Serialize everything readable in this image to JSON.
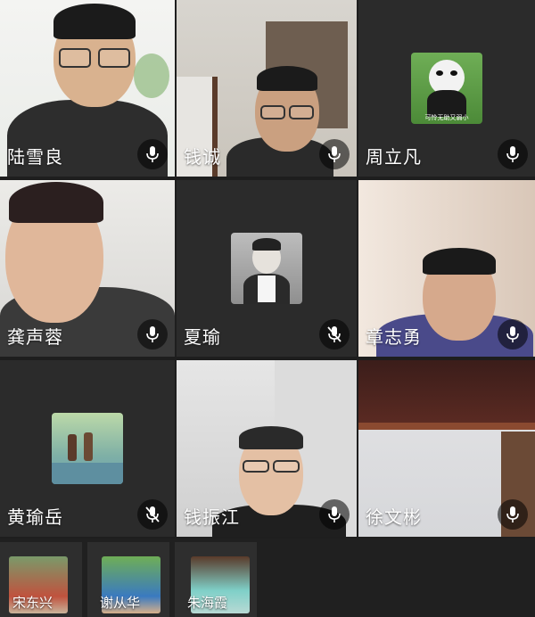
{
  "participants": [
    {
      "name": "陆雪良",
      "mic": "on",
      "kind": "video"
    },
    {
      "name": "钱诚",
      "mic": "on",
      "kind": "video"
    },
    {
      "name": "周立凡",
      "mic": "on",
      "kind": "avatar",
      "avatar_caption": "可怜无助又弱小"
    },
    {
      "name": "龚声蓉",
      "mic": "on",
      "kind": "video"
    },
    {
      "name": "夏瑜",
      "mic": "muted",
      "kind": "avatar"
    },
    {
      "name": "章志勇",
      "mic": "on",
      "kind": "video"
    },
    {
      "name": "黄瑜岳",
      "mic": "muted",
      "kind": "avatar"
    },
    {
      "name": "钱振江",
      "mic": "on",
      "kind": "video"
    },
    {
      "name": "徐文彬",
      "mic": "on",
      "kind": "video"
    }
  ],
  "strip": [
    {
      "name": "宋东兴"
    },
    {
      "name": "谢从华"
    },
    {
      "name": "朱海霞"
    }
  ],
  "colors": {
    "background": "#1e1e1e",
    "tile": "#2b2b2b",
    "text": "#ffffff"
  }
}
